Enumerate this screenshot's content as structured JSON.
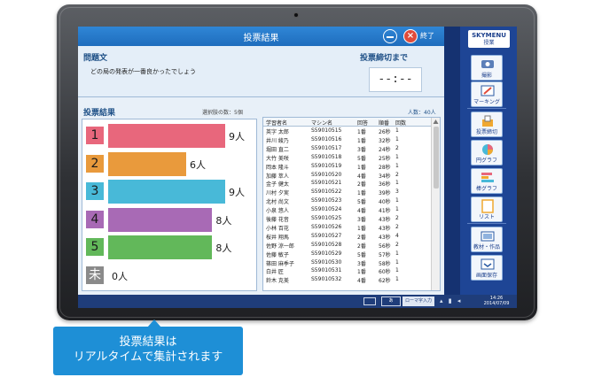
{
  "app": {
    "title": "投票結果",
    "close_label": "終了"
  },
  "question": {
    "label": "問題文",
    "text": "どの局の発表が一番良かったでしょう",
    "deadline_label": "投票締切まで",
    "deadline_value": "--:--"
  },
  "results": {
    "label": "投票結果",
    "choices_info": "選択肢の数：5個",
    "count_info": "人数：40人"
  },
  "chart_data": {
    "type": "bar",
    "orientation": "horizontal",
    "categories": [
      "1",
      "2",
      "3",
      "4",
      "5",
      "未"
    ],
    "values": [
      9,
      6,
      9,
      8,
      8,
      0
    ],
    "value_labels": [
      "9人",
      "6人",
      "9人",
      "8人",
      "8人",
      "0人"
    ],
    "colors": [
      "#e8677c",
      "#e99a3c",
      "#48b9d8",
      "#a86ab5",
      "#62b85a",
      "#8a8a8a"
    ],
    "xlim": [
      0,
      9
    ]
  },
  "table": {
    "headers": [
      "学習者名",
      "マシン名",
      "回答",
      "順番",
      "回数"
    ],
    "rows": [
      [
        "英字 太郎",
        "S59010515",
        "1番",
        "26秒",
        "1"
      ],
      [
        "井川 綾乃",
        "S59010516",
        "1番",
        "32秒",
        "1"
      ],
      [
        "堀田 直二",
        "S59010517",
        "3番",
        "24秒",
        "2"
      ],
      [
        "大竹 美咲",
        "S59010518",
        "5番",
        "25秒",
        "1"
      ],
      [
        "岡本 隆斗",
        "S59010519",
        "1番",
        "28秒",
        "1"
      ],
      [
        "加藤 萃人",
        "S59010520",
        "4番",
        "34秒",
        "2"
      ],
      [
        "金子 健太",
        "S59010521",
        "2番",
        "36秒",
        "1"
      ],
      [
        "川村 夕実",
        "S59010522",
        "1番",
        "39秒",
        "3"
      ],
      [
        "北村 尚文",
        "S59010523",
        "5番",
        "40秒",
        "1"
      ],
      [
        "小泉 悠人",
        "S59010524",
        "4番",
        "41秒",
        "1"
      ],
      [
        "後藤 花音",
        "S59010525",
        "3番",
        "43秒",
        "2"
      ],
      [
        "小林 百花",
        "S59010526",
        "1番",
        "43秒",
        "2"
      ],
      [
        "桜井 翔馬",
        "S59010527",
        "2番",
        "43秒",
        "4"
      ],
      [
        "佐野 涼一郎",
        "S59010528",
        "2番",
        "56秒",
        "2"
      ],
      [
        "佐藤 敏子",
        "S59010529",
        "5番",
        "57秒",
        "1"
      ],
      [
        "篠田 麻季子",
        "S59010530",
        "3番",
        "58秒",
        "1"
      ],
      [
        "白井 匠",
        "S59010531",
        "1番",
        "60秒",
        "1"
      ],
      [
        "鈴木 克美",
        "S59010532",
        "4番",
        "62秒",
        "1"
      ]
    ]
  },
  "toolbar": {
    "logo_main": "SKYMENU",
    "logo_sub": "授業",
    "buttons": [
      {
        "label": "撮影",
        "icon": "projector-icon"
      },
      {
        "label": "マーキング",
        "icon": "marking-pen-icon"
      },
      {
        "label": "投票締切",
        "icon": "ballot-box-icon"
      },
      {
        "label": "円グラフ",
        "icon": "pie-chart-icon"
      },
      {
        "label": "棒グラフ",
        "icon": "bar-chart-icon"
      },
      {
        "label": "リスト",
        "icon": "list-icon"
      },
      {
        "label": "教材・作品",
        "icon": "materials-icon"
      },
      {
        "label": "画面保存",
        "icon": "screen-save-icon"
      }
    ]
  },
  "taskbar": {
    "ime": "あ",
    "ime_mode": "ローマ字入力",
    "time": "14:26",
    "date": "2014/07/09"
  },
  "callout": {
    "line1": "投票結果は",
    "line2": "リアルタイムで集計されます"
  }
}
